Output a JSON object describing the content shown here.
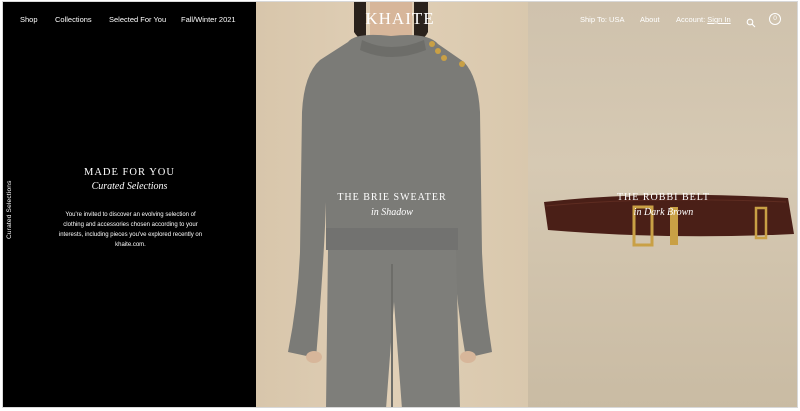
{
  "nav": {
    "shop": "Shop",
    "collections": "Collections",
    "selected": "Selected For You",
    "season": "Fall/Winter 2021",
    "logo": "KHAITE",
    "ship_to": "Ship To: USA",
    "about": "About",
    "account_prefix": "Account:",
    "sign_in": "Sign In",
    "cart_count": "0"
  },
  "intro": {
    "side_label": "Curated Selections",
    "title": "MADE FOR YOU",
    "subtitle": "Curated Selections",
    "body": "You're invited to discover an evolving selection of clothing and accessories chosen according to your interests, including pieces you've explored recently on khaite.com."
  },
  "products": [
    {
      "title": "THE BRIE SWEATER",
      "subtitle": "in Shadow"
    },
    {
      "title": "THE ROBBI BELT",
      "subtitle": "in Dark Brown"
    }
  ],
  "colors": {
    "panel_left": "#000000",
    "sweater": "#7b7b77",
    "belt": "#4a1f17",
    "hardware": "#c9a045"
  },
  "icons": [
    "search-icon",
    "cart-icon"
  ]
}
